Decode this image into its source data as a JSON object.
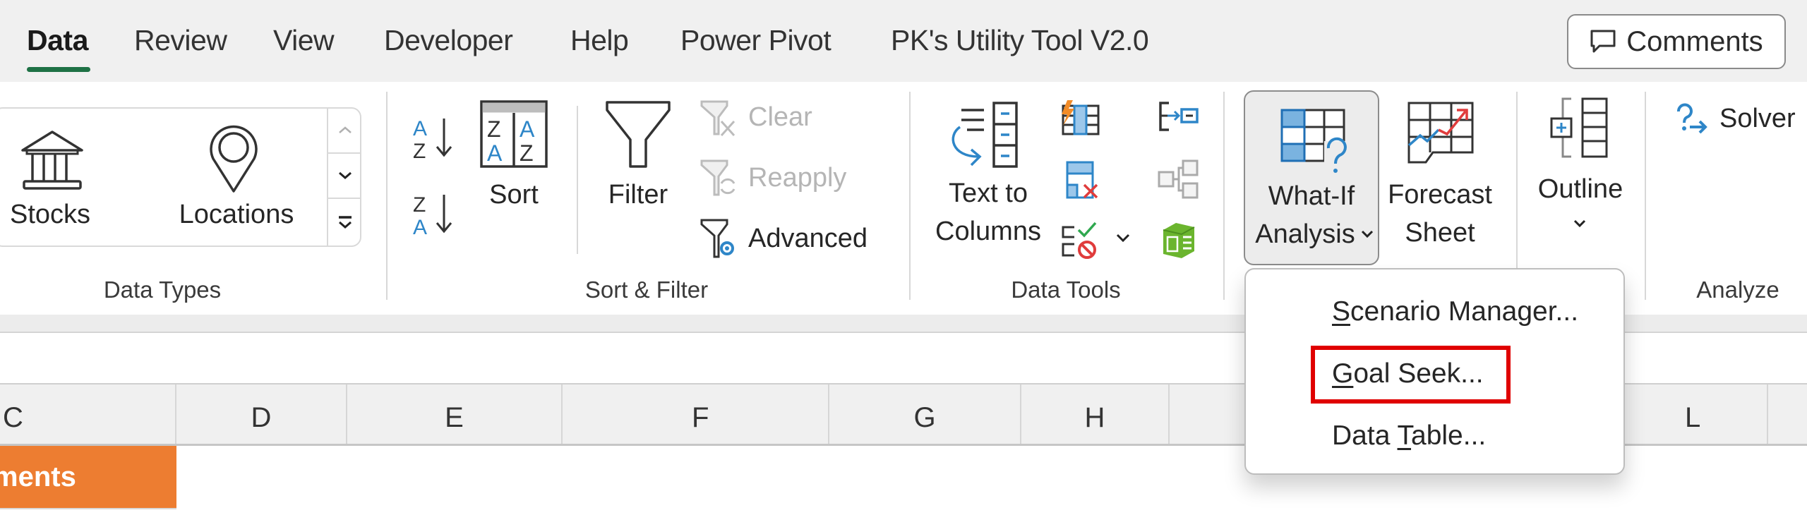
{
  "tabs": [
    {
      "label": "Data",
      "active": true
    },
    {
      "label": "Review",
      "active": false
    },
    {
      "label": "View",
      "active": false
    },
    {
      "label": "Developer",
      "active": false
    },
    {
      "label": "Help",
      "active": false
    },
    {
      "label": "Power Pivot",
      "active": false
    },
    {
      "label": "PK's Utility Tool V2.0",
      "active": false
    }
  ],
  "comments_button": {
    "label": "Comments",
    "icon": "comment-icon"
  },
  "ribbon": {
    "data_types": {
      "label": "Data Types",
      "items": [
        {
          "label": "Stocks",
          "icon": "bank-icon"
        },
        {
          "label": "Locations",
          "icon": "map-pin-icon"
        }
      ]
    },
    "sort_filter": {
      "label": "Sort & Filter",
      "sort_az_icon": "sort-a-to-z-icon",
      "sort_za_icon": "sort-z-to-a-icon",
      "sort": "Sort",
      "filter": "Filter",
      "clear": "Clear",
      "reapply": "Reapply",
      "advanced": "Advanced"
    },
    "data_tools": {
      "label": "Data Tools",
      "text_to_columns_line1": "Text to",
      "text_to_columns_line2": "Columns"
    },
    "forecast": {
      "whatif_line1": "What-If",
      "whatif_line2": "Analysis",
      "forecast_line1": "Forecast",
      "forecast_line2": "Sheet"
    },
    "outline": {
      "label": "Outline"
    },
    "analyze": {
      "label": "Analyze",
      "solver": "Solver"
    }
  },
  "whatif_menu": {
    "items": [
      {
        "label": "Scenario Manager...",
        "accel": "S",
        "highlighted": false
      },
      {
        "label": "Goal Seek...",
        "accel": "G",
        "highlighted": true
      },
      {
        "label": "Data Table...",
        "accel": "T",
        "highlighted": false
      }
    ],
    "highlight_color": "#e00000"
  },
  "sheet": {
    "columns": [
      "C",
      "D",
      "E",
      "F",
      "G",
      "H",
      "",
      "L"
    ],
    "cell_c1": "ments",
    "header_fill": "#ed7d31"
  },
  "colors": {
    "accent_green": "#1e7145",
    "icon_blue": "#2e86c8"
  }
}
